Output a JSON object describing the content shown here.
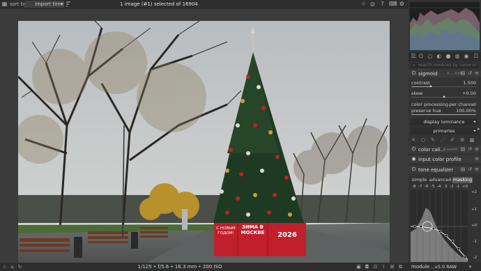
{
  "topbar": {
    "sort_label": "sort by",
    "sort_value": "import time",
    "selection_text": "1 image (#1) selected of 16904"
  },
  "panel": {
    "search_placeholder": "search modules by name or tag",
    "module": {
      "name": "sigmoid",
      "instance": "4 ... 4.00",
      "contrast_label": "contrast",
      "contrast_value": "1.500",
      "contrast_fraction": 0.3,
      "skew_label": "skew",
      "skew_value": "+0.00",
      "skew_fraction": 0.5,
      "color_processing_label": "color processing",
      "color_processing_value": "per channel",
      "preserve_hue_label": "preserve hue",
      "preserve_hue_value": "100.00%",
      "preserve_hue_fraction": 1.0,
      "display_luminance_label": "display luminance",
      "primaries_label": "primaries"
    },
    "modules": [
      {
        "name": "color cali...",
        "instance": "4 avsmt"
      },
      {
        "name": "input color profile",
        "instance": ""
      },
      {
        "name": "tone equalizer",
        "instance": ""
      }
    ],
    "tabs": [
      "simple",
      "advanced",
      "masking"
    ],
    "active_tab": "masking",
    "ev_scale": [
      "-8",
      "-7",
      "-6",
      "-5",
      "-4",
      "-3",
      "-2",
      "-1",
      "+0"
    ],
    "curve_scale": [
      "+2",
      "+1",
      "+0",
      "-1",
      "-2"
    ]
  },
  "bottombar": {
    "exif": "1/125 • f/5.6 • 18.3 mm • 200 ISO",
    "module_label": "module ...",
    "raw_label": "v5.0 RAW"
  },
  "photo": {
    "banner_left": "С НОВЫМ ГОДОМ!",
    "banner_middle": "ЗИМА В МОСКВЕ",
    "banner_right": "2026"
  },
  "colors": {
    "accent_red": "#c0202b",
    "tree_green": "#1f3a22",
    "sky": "#c2c5c7"
  }
}
